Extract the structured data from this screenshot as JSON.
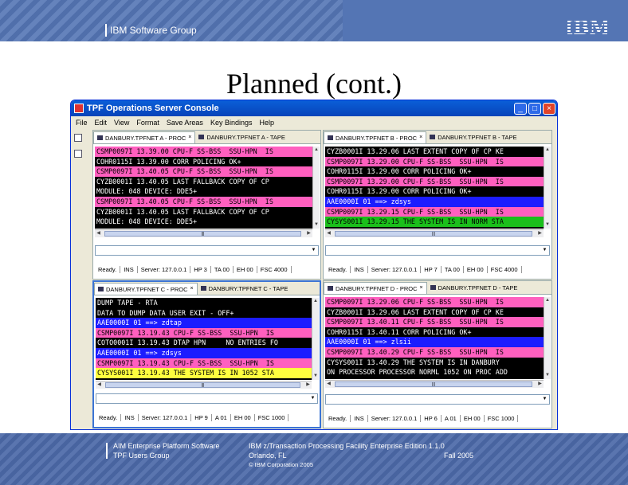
{
  "header": {
    "group": "IBM Software Group",
    "logo": "IBM"
  },
  "slide": {
    "title": "Planned (cont.)"
  },
  "window": {
    "title": "TPF Operations Server Console",
    "menu": [
      "File",
      "Edit",
      "View",
      "Format",
      "Save Areas",
      "Key Bindings",
      "Help"
    ],
    "panels": [
      {
        "tabs": [
          "DANBURY.TPFNET A - PROC",
          "DANBURY.TPFNET A - TAPE"
        ],
        "lines": [
          {
            "text": "CSMP0097I 13.39.00 CPU-F SS-BSS  SSU-HPN  IS",
            "fg": "#000",
            "bg": "#ff5fbf"
          },
          {
            "text": "COHR0115I 13.39.00 CORR POLICING OK+",
            "fg": "#fff",
            "bg": "#000"
          },
          {
            "text": "CSMP0097I 13.40.05 CPU-F SS-BSS  SSU-HPN  IS",
            "fg": "#000",
            "bg": "#ff5fbf"
          },
          {
            "text": "CYZB0001I 13.40.05 LAST FALLBACK COPY OF CP",
            "fg": "#fff",
            "bg": "#000"
          },
          {
            "text": "MODULE: 048 DEVICE: DDE5+",
            "fg": "#fff",
            "bg": "#000"
          },
          {
            "text": "CSMP0097I 13.40.05 CPU-F SS-BSS  SSU-HPN  IS",
            "fg": "#000",
            "bg": "#ff5fbf"
          },
          {
            "text": "CYZB0001I 13.40.05 LAST FALLBACK COPY OF CP",
            "fg": "#fff",
            "bg": "#000"
          },
          {
            "text": "MODULE: 048 DEVICE: DDE5+",
            "fg": "#fff",
            "bg": "#000"
          }
        ],
        "status": [
          "Ready.",
          "INS",
          "Server: 127.0.0.1",
          "HP 3",
          "TA 00",
          "EH 00",
          "FSC 4000"
        ]
      },
      {
        "tabs": [
          "DANBURY.TPFNET B - PROC",
          "DANBURY.TPFNET B - TAPE"
        ],
        "lines": [
          {
            "text": "CYZB0001I 13.29.06 LAST EXTENT COPY OF CP KE",
            "fg": "#fff",
            "bg": "#000"
          },
          {
            "text": "CSMP0097I 13.29.00 CPU-F SS-BSS  SSU-HPN  IS",
            "fg": "#000",
            "bg": "#ff5fbf"
          },
          {
            "text": "COHR0115I 13.29.00 CORR POLICING OK+",
            "fg": "#fff",
            "bg": "#000"
          },
          {
            "text": "CSMP0097I 13.29.00 CPU-F SS-BSS  SSU-HPN  IS",
            "fg": "#000",
            "bg": "#ff5fbf"
          },
          {
            "text": "COHR0115I 13.29.00 CORR POLICING OK+",
            "fg": "#fff",
            "bg": "#000"
          },
          {
            "text": "AAE0000I 01 ==> zdsys",
            "fg": "#fff",
            "bg": "#1c1cff"
          },
          {
            "text": "CSMP0097I 13.29.15 CPU-F SS-BSS  SSU-HPN  IS",
            "fg": "#000",
            "bg": "#ff5fbf"
          },
          {
            "text": "CYSYS001I 13.29.15 THE SYSTEM IS IN NORM STA",
            "fg": "#000",
            "bg": "#1bbf1b"
          }
        ],
        "status": [
          "Ready.",
          "INS",
          "Server: 127.0.0.1",
          "HP 7",
          "TA 00",
          "EH 00",
          "FSC 4000"
        ]
      },
      {
        "tabs": [
          "DANBURY.TPFNET C - PROC",
          "DANBURY.TPFNET C - TAPE"
        ],
        "lines": [
          {
            "text": "DUMP TAPE - RTA",
            "fg": "#fff",
            "bg": "#000"
          },
          {
            "text": "DATA TO DUMP DATA USER EXIT - OFF+",
            "fg": "#fff",
            "bg": "#000"
          },
          {
            "text": "AAE0000I 01 ==> zdtap",
            "fg": "#fff",
            "bg": "#1c1cff"
          },
          {
            "text": "CSMP0097I 13.19.43 CPU-F SS-BSS  SSU-HPN  IS",
            "fg": "#000",
            "bg": "#ff5fbf"
          },
          {
            "text": "COTO0001I 13.19.43 DTAP HPN     NO ENTRIES FO",
            "fg": "#fff",
            "bg": "#000"
          },
          {
            "text": "AAE0000I 01 ==> zdsys",
            "fg": "#fff",
            "bg": "#1c1cff"
          },
          {
            "text": "CSMP0097I 13.19.43 CPU-F SS-BSS  SSU-HPN  IS",
            "fg": "#000",
            "bg": "#ff5fbf"
          },
          {
            "text": "CYSYS001I 13.19.43 THE SYSTEM IS IN 1052 STA",
            "fg": "#000",
            "bg": "#ffff3f"
          }
        ],
        "status": [
          "Ready.",
          "INS",
          "Server: 127.0.0.1",
          "HP 9",
          "A 01",
          "EH 00",
          "FSC 1000"
        ]
      },
      {
        "tabs": [
          "DANBURY.TPFNET D - PROC",
          "DANBURY.TPFNET D - TAPE"
        ],
        "lines": [
          {
            "text": "CSMP0097I 13.29.06 CPU-F SS-BSS  SSU-HPN  IS",
            "fg": "#000",
            "bg": "#ff5fbf"
          },
          {
            "text": "CYZB0001I 13.29.06 LAST EXTENT COPY OF CP KE",
            "fg": "#fff",
            "bg": "#000"
          },
          {
            "text": "CSMP0097I 13.40.11 CPU-F SS-BSS  SSU-HPN  IS",
            "fg": "#000",
            "bg": "#ff5fbf"
          },
          {
            "text": "COHR0115I 13.40.11 CORR POLICING OK+",
            "fg": "#fff",
            "bg": "#000"
          },
          {
            "text": "AAE0000I 01 ==> zlsii",
            "fg": "#fff",
            "bg": "#1c1cff"
          },
          {
            "text": "CSMP0097I 13.40.29 CPU-F SS-BSS  SSU-HPN  IS",
            "fg": "#000",
            "bg": "#ff5fbf"
          },
          {
            "text": "CYSYS001I 13.40.29 THE SYSTEM IS IN DANBURY",
            "fg": "#fff",
            "bg": "#000"
          },
          {
            "text": "ON PROCESSOR PROCESSOR NORML 1052 ON PROC ADD",
            "fg": "#fff",
            "bg": "#000"
          }
        ],
        "status": [
          "Ready.",
          "INS",
          "Server: 127.0.0.1",
          "HP 6",
          "A 01",
          "EH 00",
          "FSC 1000"
        ]
      }
    ]
  },
  "footer": {
    "left1": "AIM Enterprise Platform Software",
    "left2": "TPF Users Group",
    "right1": "IBM z/Transaction Processing Facility Enterprise Edition 1.1.0",
    "location": "Orlando, FL",
    "date": "Fall 2005",
    "copyright": "© IBM Corporation 2005"
  }
}
